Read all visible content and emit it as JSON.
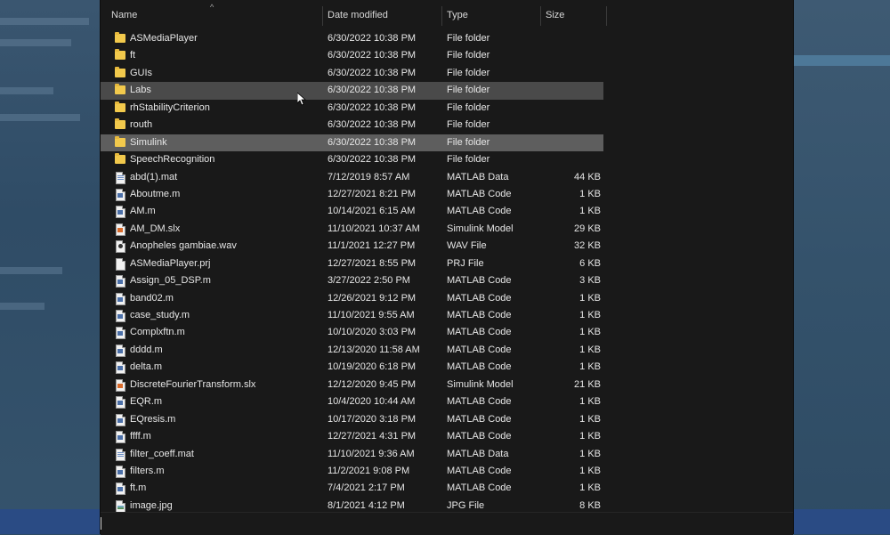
{
  "columns": {
    "name": "Name",
    "date": "Date modified",
    "type": "Type",
    "size": "Size"
  },
  "files": [
    {
      "name": "ASMediaPlayer",
      "date": "6/30/2022 10:38 PM",
      "type": "File folder",
      "size": "",
      "icon": "folder-icon",
      "state": ""
    },
    {
      "name": "ft",
      "date": "6/30/2022 10:38 PM",
      "type": "File folder",
      "size": "",
      "icon": "folder-icon",
      "state": ""
    },
    {
      "name": "GUIs",
      "date": "6/30/2022 10:38 PM",
      "type": "File folder",
      "size": "",
      "icon": "folder-icon",
      "state": ""
    },
    {
      "name": "Labs",
      "date": "6/30/2022 10:38 PM",
      "type": "File folder",
      "size": "",
      "icon": "folder-icon",
      "state": "hover"
    },
    {
      "name": "rhStabilityCriterion",
      "date": "6/30/2022 10:38 PM",
      "type": "File folder",
      "size": "",
      "icon": "folder-icon",
      "state": ""
    },
    {
      "name": "routh",
      "date": "6/30/2022 10:38 PM",
      "type": "File folder",
      "size": "",
      "icon": "folder-icon",
      "state": ""
    },
    {
      "name": "Simulink",
      "date": "6/30/2022 10:38 PM",
      "type": "File folder",
      "size": "",
      "icon": "folder-icon",
      "state": "selected"
    },
    {
      "name": "SpeechRecognition",
      "date": "6/30/2022 10:38 PM",
      "type": "File folder",
      "size": "",
      "icon": "folder-icon",
      "state": ""
    },
    {
      "name": "abd(1).mat",
      "date": "7/12/2019 8:57 AM",
      "type": "MATLAB Data",
      "size": "44 KB",
      "icon": "mat-data-icon",
      "state": ""
    },
    {
      "name": "Aboutme.m",
      "date": "12/27/2021 8:21 PM",
      "type": "MATLAB Code",
      "size": "1 KB",
      "icon": "matlab-code-icon",
      "state": ""
    },
    {
      "name": "AM.m",
      "date": "10/14/2021 6:15 AM",
      "type": "MATLAB Code",
      "size": "1 KB",
      "icon": "matlab-code-icon",
      "state": ""
    },
    {
      "name": "AM_DM.slx",
      "date": "11/10/2021 10:37 AM",
      "type": "Simulink Model",
      "size": "29 KB",
      "icon": "simulink-model-icon",
      "state": ""
    },
    {
      "name": "Anopheles gambiae.wav",
      "date": "11/1/2021 12:27 PM",
      "type": "WAV File",
      "size": "32 KB",
      "icon": "wav-file-icon",
      "state": ""
    },
    {
      "name": "ASMediaPlayer.prj",
      "date": "12/27/2021 8:55 PM",
      "type": "PRJ File",
      "size": "6 KB",
      "icon": "prj-file-icon",
      "state": ""
    },
    {
      "name": "Assign_05_DSP.m",
      "date": "3/27/2022 2:50 PM",
      "type": "MATLAB Code",
      "size": "3 KB",
      "icon": "matlab-code-icon",
      "state": ""
    },
    {
      "name": "band02.m",
      "date": "12/26/2021 9:12 PM",
      "type": "MATLAB Code",
      "size": "1 KB",
      "icon": "matlab-code-icon",
      "state": ""
    },
    {
      "name": "case_study.m",
      "date": "11/10/2021 9:55 AM",
      "type": "MATLAB Code",
      "size": "1 KB",
      "icon": "matlab-code-icon",
      "state": ""
    },
    {
      "name": "Complxftn.m",
      "date": "10/10/2020 3:03 PM",
      "type": "MATLAB Code",
      "size": "1 KB",
      "icon": "matlab-code-icon",
      "state": ""
    },
    {
      "name": "dddd.m",
      "date": "12/13/2020 11:58 AM",
      "type": "MATLAB Code",
      "size": "1 KB",
      "icon": "matlab-code-icon",
      "state": ""
    },
    {
      "name": "delta.m",
      "date": "10/19/2020 6:18 PM",
      "type": "MATLAB Code",
      "size": "1 KB",
      "icon": "matlab-code-icon",
      "state": ""
    },
    {
      "name": "DiscreteFourierTransform.slx",
      "date": "12/12/2020 9:45 PM",
      "type": "Simulink Model",
      "size": "21 KB",
      "icon": "simulink-model-icon",
      "state": ""
    },
    {
      "name": "EQR.m",
      "date": "10/4/2020 10:44 AM",
      "type": "MATLAB Code",
      "size": "1 KB",
      "icon": "matlab-code-icon",
      "state": ""
    },
    {
      "name": "EQresis.m",
      "date": "10/17/2020 3:18 PM",
      "type": "MATLAB Code",
      "size": "1 KB",
      "icon": "matlab-code-icon",
      "state": ""
    },
    {
      "name": "ffff.m",
      "date": "12/27/2021 4:31 PM",
      "type": "MATLAB Code",
      "size": "1 KB",
      "icon": "matlab-code-icon",
      "state": ""
    },
    {
      "name": "filter_coeff.mat",
      "date": "11/10/2021 9:36 AM",
      "type": "MATLAB Data",
      "size": "1 KB",
      "icon": "mat-data-icon",
      "state": ""
    },
    {
      "name": "filters.m",
      "date": "11/2/2021 9:08 PM",
      "type": "MATLAB Code",
      "size": "1 KB",
      "icon": "matlab-code-icon",
      "state": ""
    },
    {
      "name": "ft.m",
      "date": "7/4/2021 2:17 PM",
      "type": "MATLAB Code",
      "size": "1 KB",
      "icon": "matlab-code-icon",
      "state": ""
    },
    {
      "name": "image.jpg",
      "date": "8/1/2021 4:12 PM",
      "type": "JPG File",
      "size": "8 KB",
      "icon": "image-file-icon",
      "state": ""
    }
  ],
  "colors": {
    "dialog_bg": "#191919",
    "hover_row": "#4a4a4a",
    "selected_row": "#5e5e5e",
    "folder": "#f2c94c",
    "desktop_bg": "#2d4a63"
  }
}
